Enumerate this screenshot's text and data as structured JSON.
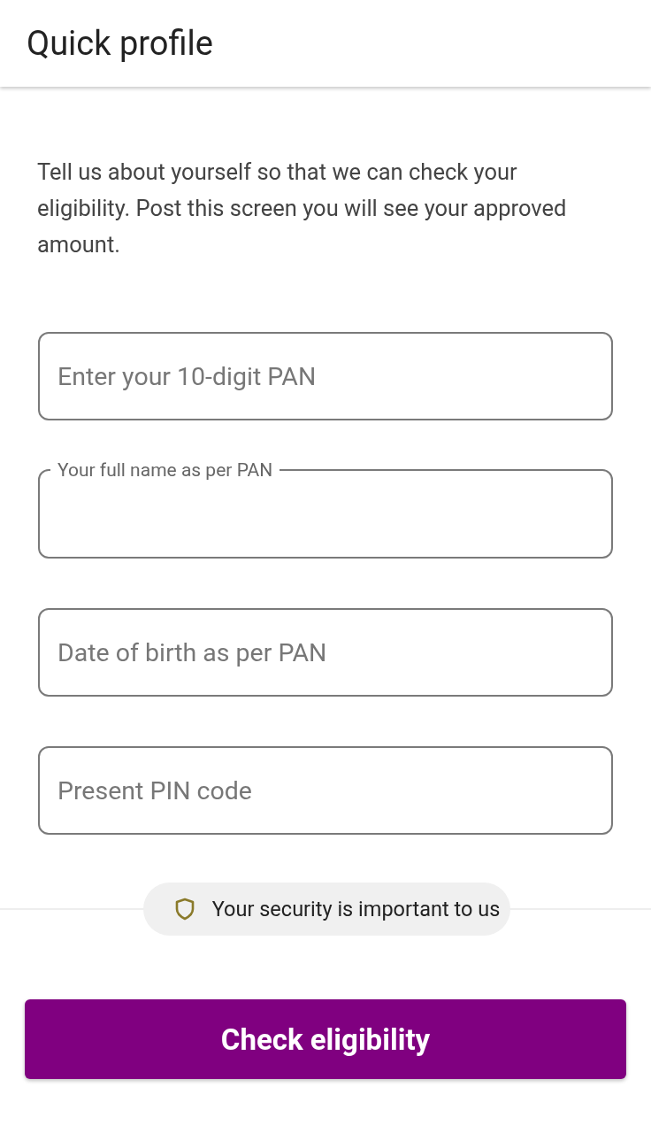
{
  "header": {
    "title": "Quick profile"
  },
  "intro": "Tell us about yourself so that we can check your eligibility. Post this screen you will see your approved amount.",
  "fields": [
    {
      "placeholder": "Enter your 10-digit PAN"
    },
    {
      "label": "Your full name as per PAN"
    },
    {
      "placeholder": "Date of birth as per PAN"
    },
    {
      "placeholder": "Present PIN code"
    }
  ],
  "security_note": "Your security is important to us",
  "submit_button": "Check eligibility"
}
